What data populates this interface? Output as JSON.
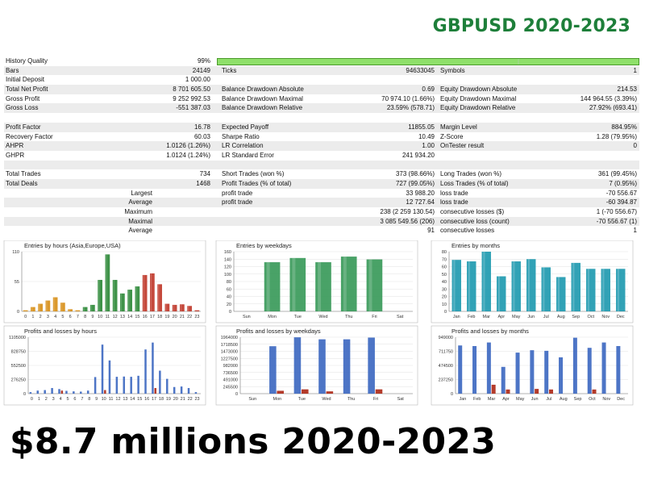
{
  "header": {
    "title": "GBPUSD 2020-2023"
  },
  "report": {
    "rows": [
      {
        "shade": false,
        "c": [
          "History Quality",
          "99%",
          "",
          "",
          "",
          ""
        ]
      },
      {
        "shade": true,
        "c": [
          "Bars",
          "24149",
          "Ticks",
          "94633045",
          "Symbols",
          "1"
        ]
      },
      {
        "shade": false,
        "c": [
          "Initial Deposit",
          "1 000.00",
          "",
          "",
          "",
          ""
        ]
      },
      {
        "shade": true,
        "c": [
          "Total Net Profit",
          "8 701 605.50",
          "Balance Drawdown Absolute",
          "0.69",
          "Equity Drawdown Absolute",
          "214.53"
        ]
      },
      {
        "shade": false,
        "c": [
          "Gross Profit",
          "9 252 992.53",
          "Balance Drawdown Maximal",
          "70 974.10 (1.66%)",
          "Equity Drawdown Maximal",
          "144 964.55 (3.39%)"
        ]
      },
      {
        "shade": true,
        "c": [
          "Gross Loss",
          "-551 387.03",
          "Balance Drawdown Relative",
          "23.59% (578.71)",
          "Equity Drawdown Relative",
          "27.92% (693.41)"
        ]
      },
      {
        "shade": false,
        "c": [
          "",
          "",
          "",
          "",
          "",
          ""
        ]
      },
      {
        "shade": true,
        "c": [
          "Profit Factor",
          "16.78",
          "Expected Payoff",
          "11855.05",
          "Margin Level",
          "884.95%"
        ]
      },
      {
        "shade": false,
        "c": [
          "Recovery Factor",
          "60.03",
          "Sharpe Ratio",
          "10.49",
          "Z-Score",
          "1.28 (79.95%)"
        ]
      },
      {
        "shade": true,
        "c": [
          "AHPR",
          "1.0126 (1.26%)",
          "LR Correlation",
          "1.00",
          "OnTester result",
          "0"
        ]
      },
      {
        "shade": false,
        "c": [
          "GHPR",
          "1.0124 (1.24%)",
          "LR Standard Error",
          "241 934.20",
          "",
          ""
        ]
      },
      {
        "shade": true,
        "c": [
          "",
          "",
          "",
          "",
          "",
          ""
        ]
      },
      {
        "shade": false,
        "c": [
          "Total Trades",
          "734",
          "Short Trades (won %)",
          "373 (98.66%)",
          "Long Trades (won %)",
          "361 (99.45%)"
        ]
      },
      {
        "shade": true,
        "c": [
          "Total Deals",
          "1468",
          "Profit Trades (% of total)",
          "727 (99.05%)",
          "Loss Trades (% of total)",
          "7 (0.95%)"
        ]
      },
      {
        "shade": false,
        "c": [
          "Largest",
          "",
          "profit trade",
          "33 988.20",
          "loss trade",
          "-70 556.67"
        ],
        "ra": true
      },
      {
        "shade": true,
        "c": [
          "Average",
          "",
          "profit trade",
          "12 727.64",
          "loss trade",
          "-60 394.87"
        ],
        "ra": true
      },
      {
        "shade": false,
        "c": [
          "Maximum",
          "",
          "",
          "238 (2 259 130.54)",
          "consecutive losses ($)",
          "1 (-70 556.67)"
        ],
        "ra": true
      },
      {
        "shade": true,
        "c": [
          "Maximal",
          "",
          "",
          "3 085 549.56 (206)",
          "consecutive loss (count)",
          "-70 556.67 (1)"
        ],
        "ra": true
      },
      {
        "shade": false,
        "c": [
          "Average",
          "",
          "",
          "91",
          "consecutive losses",
          "1"
        ],
        "ra": true
      }
    ]
  },
  "chart_data": [
    {
      "type": "bar",
      "title": "Entries by hours (Asia,Europe,USA)",
      "categories": [
        "0",
        "1",
        "2",
        "3",
        "4",
        "5",
        "6",
        "7",
        "8",
        "9",
        "10",
        "11",
        "12",
        "13",
        "14",
        "15",
        "16",
        "17",
        "18",
        "19",
        "20",
        "21",
        "22",
        "23"
      ],
      "values": [
        2,
        8,
        14,
        20,
        26,
        16,
        4,
        2,
        8,
        12,
        58,
        105,
        58,
        33,
        40,
        46,
        67,
        70,
        50,
        14,
        12,
        13,
        10,
        2
      ],
      "colors_by_range": [
        [
          "0-7",
          "#d8901a"
        ],
        [
          "8-15",
          "#2f8a3a"
        ],
        [
          "16-23",
          "#c0392b"
        ]
      ],
      "yticks": [
        "0",
        "55",
        "110"
      ],
      "ylim": [
        0,
        110
      ]
    },
    {
      "type": "bar",
      "title": "Entries by weekdays",
      "categories": [
        "Sun",
        "Mon",
        "Tue",
        "Wed",
        "Thu",
        "Fri",
        "Sat"
      ],
      "values": [
        0,
        140,
        152,
        140,
        156,
        148,
        0
      ],
      "color": "#3a9a5a",
      "yticks": [
        "0",
        "20",
        "40",
        "60",
        "80",
        "100",
        "120",
        "140",
        "160"
      ],
      "ylim": [
        0,
        170
      ]
    },
    {
      "type": "bar",
      "title": "Entries by months",
      "categories": [
        "Jan",
        "Feb",
        "Mar",
        "Apr",
        "May",
        "Jun",
        "Jul",
        "Aug",
        "Sep",
        "Oct",
        "Nov",
        "Dec"
      ],
      "values": [
        69,
        67,
        80,
        47,
        67,
        70,
        59,
        46,
        65,
        57,
        57,
        57
      ],
      "color": "#1f9ab0",
      "yticks": [
        "0",
        "10",
        "20",
        "30",
        "40",
        "50",
        "60",
        "70",
        "80"
      ],
      "ylim": [
        0,
        80
      ]
    },
    {
      "type": "bar",
      "title": "Profits and losses by hours",
      "categories": [
        "0",
        "1",
        "2",
        "3",
        "4",
        "5",
        "6",
        "7",
        "8",
        "9",
        "10",
        "11",
        "12",
        "13",
        "14",
        "15",
        "16",
        "17",
        "18",
        "19",
        "20",
        "21",
        "22",
        "23"
      ],
      "series": [
        {
          "values": [
            30000,
            60000,
            70000,
            110000,
            90000,
            55000,
            45000,
            40000,
            60000,
            325000,
            960000,
            650000,
            330000,
            335000,
            330000,
            350000,
            865000,
            1000000,
            450000,
            290000,
            130000,
            140000,
            110000,
            30000
          ],
          "color": "#3a66c0"
        },
        {
          "values": [
            0,
            0,
            0,
            0,
            60000,
            0,
            0,
            0,
            0,
            0,
            70000,
            0,
            0,
            0,
            0,
            0,
            0,
            110000,
            0,
            0,
            0,
            0,
            0,
            0
          ],
          "color": "#b03020"
        }
      ],
      "yticks": [
        "0",
        "276250",
        "552500",
        "828750",
        "1105000"
      ],
      "ylim": [
        0,
        1105000
      ]
    },
    {
      "type": "bar",
      "title": "Profits and losses by weekdays",
      "categories": [
        "Sun",
        "Mon",
        "Tue",
        "Wed",
        "Thu",
        "Fri",
        "Sat"
      ],
      "series": [
        {
          "values": [
            0,
            1650000,
            1960000,
            1890000,
            1890000,
            1950000,
            0
          ],
          "color": "#3a66c0"
        },
        {
          "values": [
            0,
            100000,
            150000,
            80000,
            0,
            150000,
            0
          ],
          "color": "#b03020"
        }
      ],
      "yticks": [
        "0",
        "245500",
        "491000",
        "736500",
        "982000",
        "1227500",
        "1473000",
        "1718500",
        "1964000"
      ],
      "ylim": [
        0,
        1964000
      ]
    },
    {
      "type": "bar",
      "title": "Profits and losses by months",
      "categories": [
        "Jan",
        "Feb",
        "Mar",
        "Apr",
        "May",
        "Jun",
        "Jul",
        "Aug",
        "Sep",
        "Oct",
        "Nov",
        "Dec"
      ],
      "series": [
        {
          "values": [
            810000,
            800000,
            860000,
            450000,
            690000,
            730000,
            720000,
            610000,
            940000,
            770000,
            860000,
            800000
          ],
          "color": "#3a66c0"
        },
        {
          "values": [
            0,
            0,
            150000,
            70000,
            0,
            80000,
            70000,
            0,
            0,
            70000,
            0,
            0
          ],
          "color": "#b03020"
        }
      ],
      "yticks": [
        "0",
        "237250",
        "474500",
        "711750",
        "949000"
      ],
      "ylim": [
        0,
        949000
      ]
    }
  ],
  "footer": {
    "headline": "$8.7 millions 2020-2023"
  }
}
